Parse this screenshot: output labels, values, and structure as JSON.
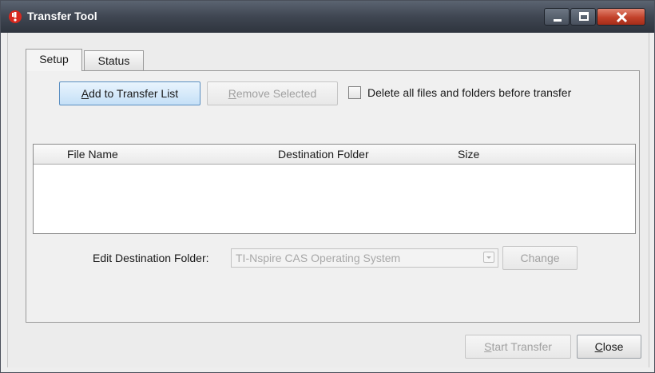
{
  "window": {
    "title": "Transfer Tool",
    "app_icon": "ti-nspire-logo-icon",
    "controls": [
      "minimize",
      "maximize",
      "close"
    ]
  },
  "tabs": [
    {
      "label": "Setup",
      "selected": true
    },
    {
      "label": "Status",
      "selected": false
    }
  ],
  "setup": {
    "add_button": {
      "mnemonic": "A",
      "rest": "dd to Transfer List"
    },
    "remove_button": {
      "mnemonic": "R",
      "rest": "emove Selected",
      "enabled": false
    },
    "delete_checkbox": {
      "label": "Delete all files and folders before transfer",
      "checked": false
    },
    "table": {
      "columns": [
        "File Name",
        "Destination Folder",
        "Size"
      ],
      "rows": []
    },
    "edit_destination": {
      "label": "Edit Destination Folder:",
      "value": "TI-Nspire CAS Operating System",
      "enabled": false,
      "change_label": "Change"
    }
  },
  "footer": {
    "start_button": {
      "mnemonic": "S",
      "rest": "tart Transfer",
      "enabled": false
    },
    "close_button": {
      "mnemonic": "C",
      "rest": "lose"
    }
  },
  "colors": {
    "titlebar": "#3f4652",
    "close_button": "#c2412a",
    "primary_button": "#c5e0f7",
    "disabled_text": "#a0a0a0"
  }
}
